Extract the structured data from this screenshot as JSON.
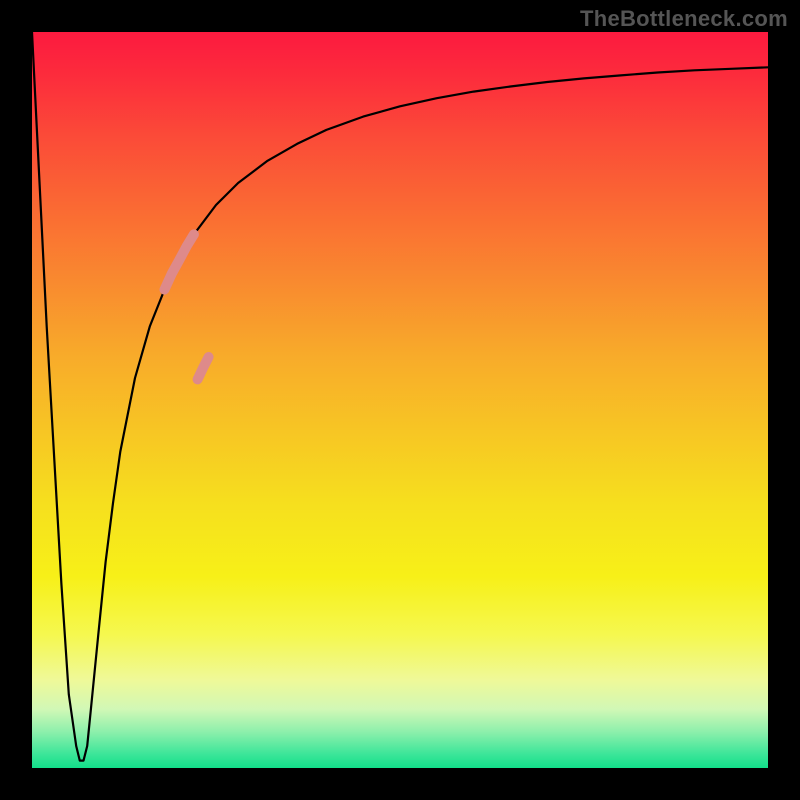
{
  "watermark": "TheBottleneck.com",
  "colors": {
    "background": "#000000",
    "curve_stroke": "#000000",
    "highlight_stroke": "#de8a8a",
    "gradient_top": "#fc1a3f",
    "gradient_bottom": "#12df8a"
  },
  "chart_data": {
    "type": "line",
    "title": "",
    "xlabel": "",
    "ylabel": "",
    "xlim": [
      0,
      100
    ],
    "ylim": [
      0,
      100
    ],
    "grid": false,
    "series": [
      {
        "name": "curve",
        "x": [
          0,
          2,
          4,
          5,
          6,
          6.5,
          7,
          7.5,
          8,
          9,
          10,
          11,
          12,
          14,
          16,
          18,
          20,
          22,
          25,
          28,
          32,
          36,
          40,
          45,
          50,
          55,
          60,
          65,
          70,
          75,
          80,
          85,
          90,
          95,
          100
        ],
        "values": [
          100,
          60,
          25,
          10,
          3,
          1,
          1,
          3,
          8,
          18,
          28,
          36,
          43,
          53,
          60,
          65,
          69,
          72.5,
          76.5,
          79.5,
          82.5,
          84.8,
          86.7,
          88.5,
          89.9,
          91,
          91.9,
          92.6,
          93.2,
          93.7,
          94.1,
          94.5,
          94.8,
          95,
          95.2
        ]
      },
      {
        "name": "highlight-segment",
        "x": [
          18,
          19,
          20,
          21,
          22,
          22.5,
          23.3,
          24
        ],
        "values": [
          65,
          67.2,
          69,
          70.9,
          72.5,
          52.8,
          54.5,
          55.8
        ]
      }
    ],
    "annotations": []
  }
}
